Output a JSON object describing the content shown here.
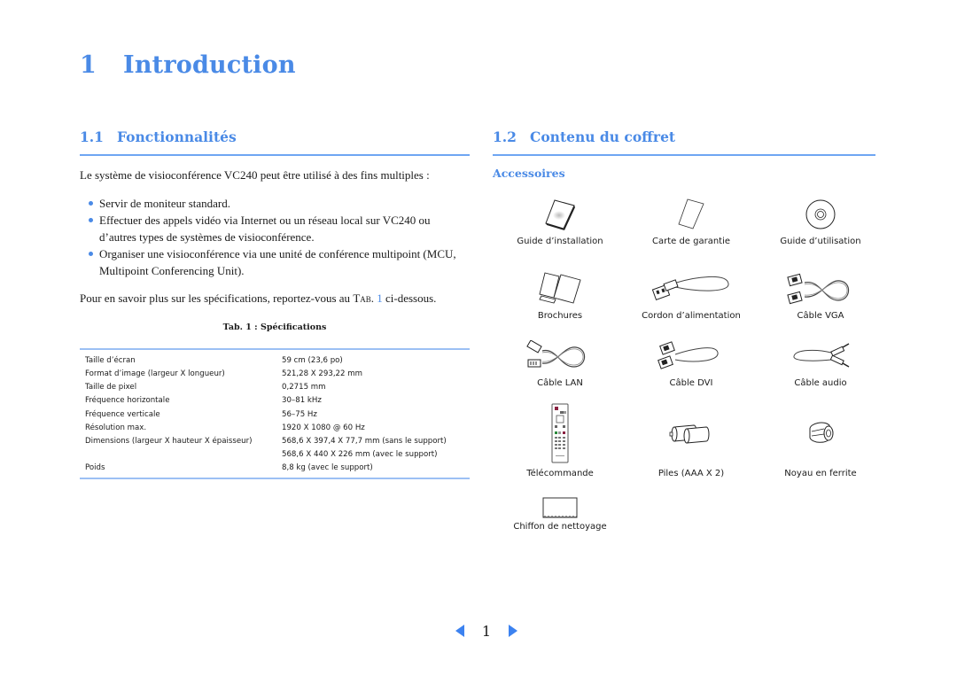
{
  "chapter": {
    "number": "1",
    "title": "Introduction"
  },
  "section_features": {
    "number": "1.1",
    "title": "Fonctionnalités",
    "intro": "Le système de visioconférence VC240 peut être utilisé à des fins multiples :",
    "bullets": [
      "Servir de moniteur standard.",
      "Effectuer des appels vidéo via Internet ou un réseau local sur VC240 ou d’autres types de systèmes de visioconférence.",
      "Organiser une visioconférence via une unité de conférence multipoint (MCU, Multipoint Conferencing Unit)."
    ],
    "more_before": "Pour en savoir plus sur les spécifications, reportez-vous au ",
    "more_tab": "Tab.",
    "more_ref": "1",
    "more_after": " ci-dessous.",
    "table_caption": "Tab. 1 : Spécifications",
    "spec_rows": [
      {
        "label": "Taille d’écran",
        "value": "59 cm (23,6 po)"
      },
      {
        "label": "Format d’image (largeur X longueur)",
        "value": "521,28 X 293,22 mm"
      },
      {
        "label": "Taille de pixel",
        "value": "0,2715 mm"
      },
      {
        "label": "Fréquence horizontale",
        "value": "30–81 kHz"
      },
      {
        "label": "Fréquence verticale",
        "value": "56–75 Hz"
      },
      {
        "label": "Résolution max.",
        "value": "1920 X 1080 @ 60 Hz"
      },
      {
        "label": "Dimensions (largeur X hauteur X épaisseur)",
        "value": "568,6 X 397,4 X 77,7 mm (sans le support)"
      },
      {
        "label": "",
        "value": "568,6 X 440 X 226 mm (avec le support)"
      },
      {
        "label": "Poids",
        "value": "8,8 kg (avec le support)"
      }
    ]
  },
  "section_contents": {
    "number": "1.2",
    "title": "Contenu du coffret",
    "subheading": "Accessoires",
    "items": [
      {
        "label": "Guide d’installation",
        "icon": "booklet-icon"
      },
      {
        "label": "Carte de garantie",
        "icon": "card-icon"
      },
      {
        "label": "Guide d’utilisation",
        "icon": "cd-icon"
      },
      {
        "label": "Brochures",
        "icon": "brochures-icon"
      },
      {
        "label": "Cordon d’alimentation",
        "icon": "power-cord-icon"
      },
      {
        "label": "Câble VGA",
        "icon": "vga-cable-icon"
      },
      {
        "label": "Câble LAN",
        "icon": "lan-cable-icon"
      },
      {
        "label": "Câble DVI",
        "icon": "dvi-cable-icon"
      },
      {
        "label": "Câble audio",
        "icon": "audio-cable-icon"
      },
      {
        "label": "Télécommande",
        "icon": "remote-control-icon"
      },
      {
        "label": "Piles (AAA X 2)",
        "icon": "batteries-icon"
      },
      {
        "label": "Noyau en ferrite",
        "icon": "ferrite-core-icon"
      },
      {
        "label": "Chiffon de nettoyage",
        "icon": "cleaning-cloth-icon"
      }
    ]
  },
  "pager": {
    "page": "1"
  },
  "colors": {
    "accent": "#4a8ae6",
    "rule": "#6ea6f2",
    "arrow": "#3c82f0"
  }
}
